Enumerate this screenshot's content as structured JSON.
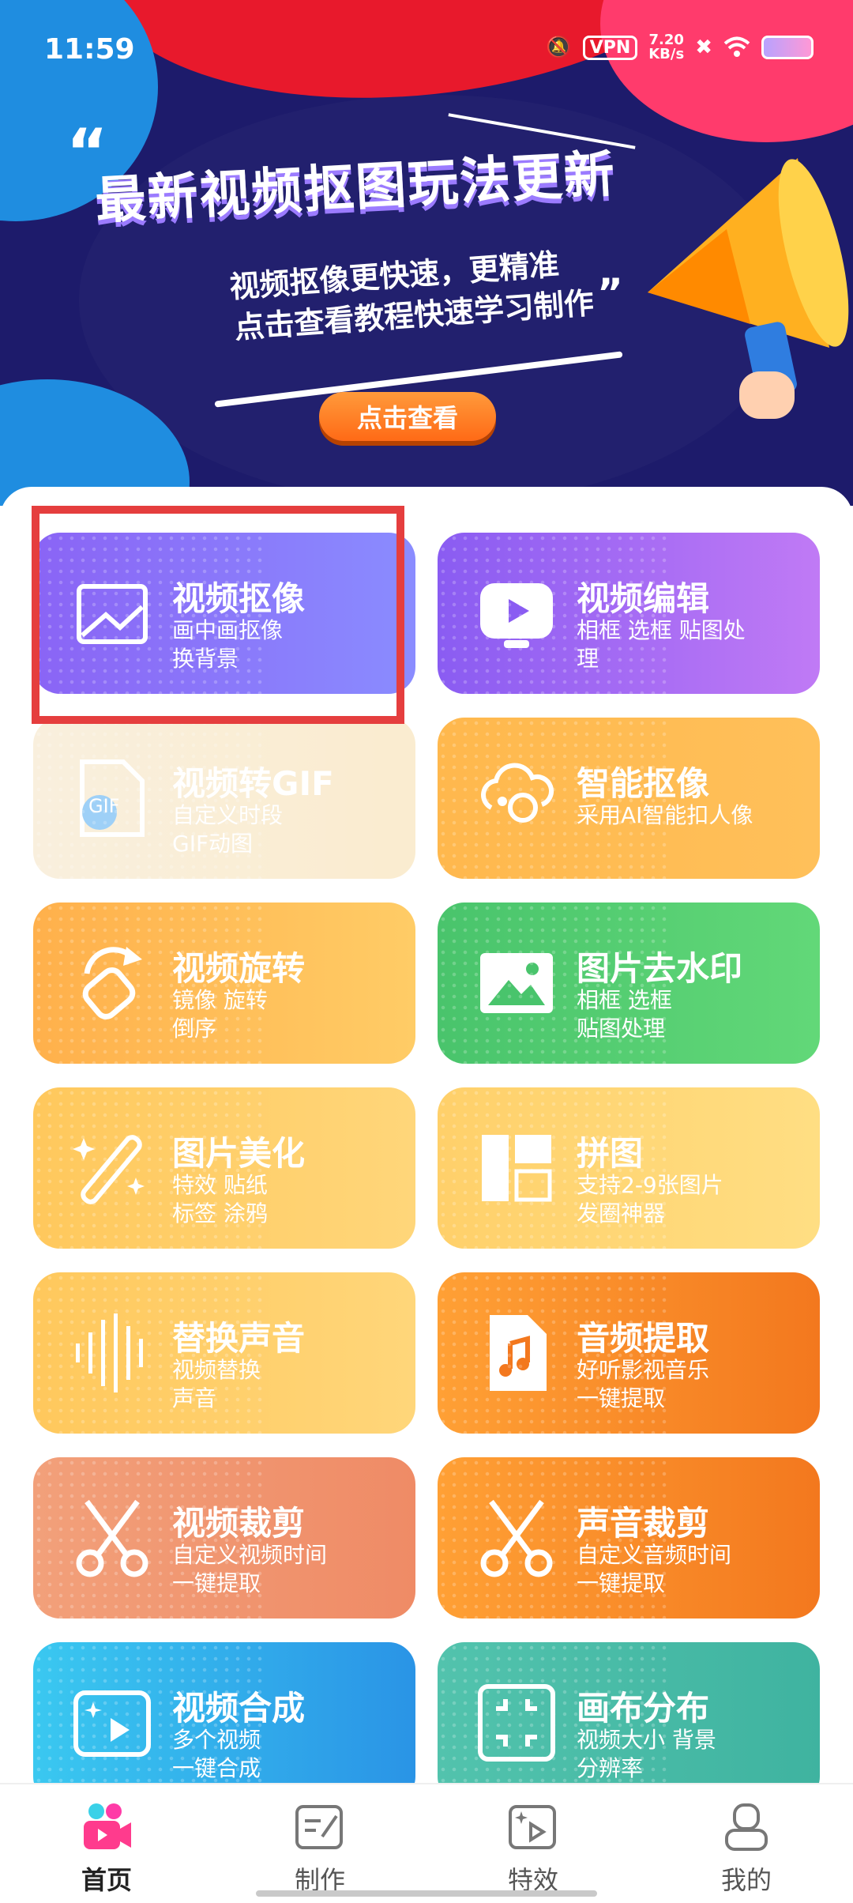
{
  "status_bar": {
    "time": "11:59",
    "vpn": "VPN",
    "speed_value": "7.20",
    "speed_unit": "KB/s"
  },
  "banner": {
    "title": "最新视频抠图玩法更新",
    "subtitle_line1": "视频抠像更快速，更精准",
    "subtitle_line2": "点击查看教程快速学习制作",
    "button": "点击查看"
  },
  "features": [
    {
      "title": "视频抠像",
      "desc1": "画中画抠像",
      "desc2": "换背景",
      "icon": "image-icon",
      "selected": true
    },
    {
      "title": "视频编辑",
      "desc1": "相框 选框 贴图处",
      "desc2": "理",
      "icon": "video-play-icon"
    },
    {
      "title": "视频转GIF",
      "desc1": "自定义时段",
      "desc2": "GIF动图",
      "icon": "gif-file-icon",
      "disabled": true
    },
    {
      "title": "智能抠像",
      "desc1": "采用AI智能扣人像",
      "desc2": "",
      "icon": "ai-portrait-icon"
    },
    {
      "title": "视频旋转",
      "desc1": "镜像 旋转",
      "desc2": "倒序",
      "icon": "rotate-icon"
    },
    {
      "title": "图片去水印",
      "desc1": "相框 选框",
      "desc2": "贴图处理",
      "icon": "picture-icon"
    },
    {
      "title": "图片美化",
      "desc1": "特效 贴纸",
      "desc2": "标签 涂鸦",
      "icon": "magic-wand-icon"
    },
    {
      "title": "拼图",
      "desc1": "支持2-9张图片",
      "desc2": "发圈神器",
      "icon": "collage-icon"
    },
    {
      "title": "替换声音",
      "desc1": "视频替换",
      "desc2": "声音",
      "icon": "sound-wave-icon"
    },
    {
      "title": "音频提取",
      "desc1": "好听影视音乐",
      "desc2": "一键提取",
      "icon": "music-file-icon"
    },
    {
      "title": "视频裁剪",
      "desc1": "自定义视频时间",
      "desc2": "一键提取",
      "icon": "scissors-icon"
    },
    {
      "title": "声音裁剪",
      "desc1": "自定义音频时间",
      "desc2": "一键提取",
      "icon": "scissors-icon"
    },
    {
      "title": "视频合成",
      "desc1": "多个视频",
      "desc2": "一键合成",
      "icon": "video-merge-icon"
    },
    {
      "title": "画布分布",
      "desc1": "视频大小 背景",
      "desc2": "分辨率",
      "icon": "canvas-frame-icon"
    }
  ],
  "bottom_nav": [
    {
      "label": "首页",
      "icon": "home-camera-icon",
      "active": true
    },
    {
      "label": "制作",
      "icon": "edit-icon"
    },
    {
      "label": "特效",
      "icon": "effects-icon"
    },
    {
      "label": "我的",
      "icon": "profile-icon"
    }
  ]
}
